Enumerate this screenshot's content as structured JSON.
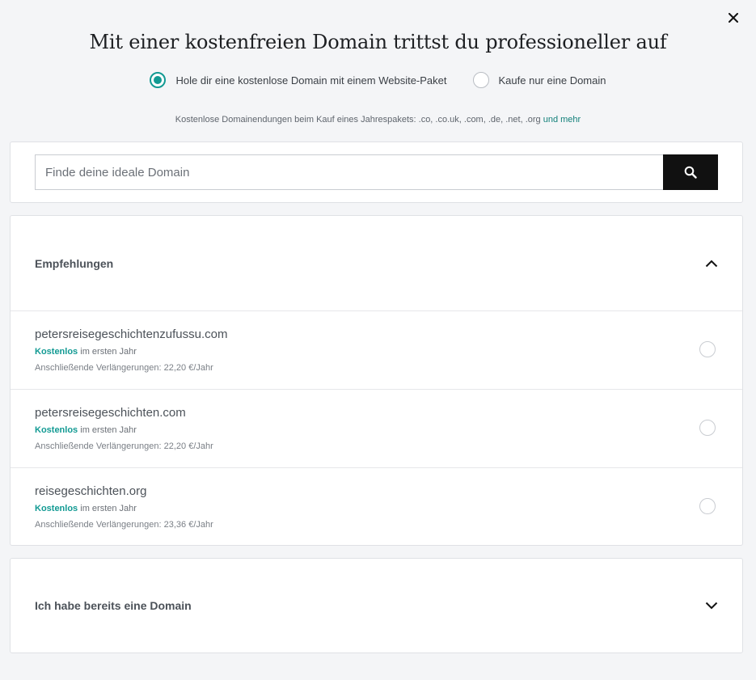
{
  "header": {
    "close_label": "×",
    "title": "Mit einer kostenfreien Domain trittst du professioneller auf"
  },
  "options": [
    {
      "label": "Hole dir eine kostenlose Domain mit einem Website-Paket",
      "selected": true
    },
    {
      "label": "Kaufe nur eine Domain",
      "selected": false
    }
  ],
  "note": {
    "text": "Kostenlose Domainendungen beim Kauf eines Jahrespakets: .co, .co.uk, .com, .de, .net, .org",
    "link": "und mehr"
  },
  "search": {
    "placeholder": "Finde deine ideale Domain",
    "value": ""
  },
  "recommendations": {
    "title": "Empfehlungen",
    "items": [
      {
        "domain": "petersreisegeschichtenzufussu.com",
        "free_label": "Kostenlos",
        "free_suffix": "im ersten Jahr",
        "renewal": "Anschließende Verlängerungen: 22,20 €/Jahr"
      },
      {
        "domain": "petersreisegeschichten.com",
        "free_label": "Kostenlos",
        "free_suffix": "im ersten Jahr",
        "renewal": "Anschließende Verlängerungen: 22,20 €/Jahr"
      },
      {
        "domain": "reisegeschichten.org",
        "free_label": "Kostenlos",
        "free_suffix": "im ersten Jahr",
        "renewal": "Anschließende Verlängerungen: 23,36 €/Jahr"
      }
    ]
  },
  "own_domain": {
    "title": "Ich habe bereits eine Domain"
  },
  "colors": {
    "accent": "#129a93",
    "search_button": "#111111",
    "background": "#f4f5f7"
  }
}
